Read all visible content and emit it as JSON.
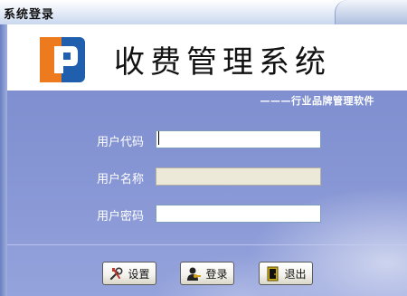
{
  "window": {
    "title": "系统登录"
  },
  "header": {
    "system_name": "收费管理系统",
    "subtitle": "———行业品牌管理软件"
  },
  "form": {
    "user_code_label": "用户代码",
    "user_code_value": "",
    "user_name_label": "用户名称",
    "user_name_value": "",
    "password_label": "用户密码",
    "password_value": ""
  },
  "buttons": {
    "settings": "设置",
    "login": "登录",
    "exit": "退出"
  },
  "icons": {
    "logo": "fp-logo-icon",
    "settings": "tools-icon",
    "login": "user-key-icon",
    "exit": "door-exit-icon"
  },
  "colors": {
    "panel": "#8695d4",
    "logo_orange": "#ee7a1e",
    "logo_blue": "#1f5fae"
  }
}
